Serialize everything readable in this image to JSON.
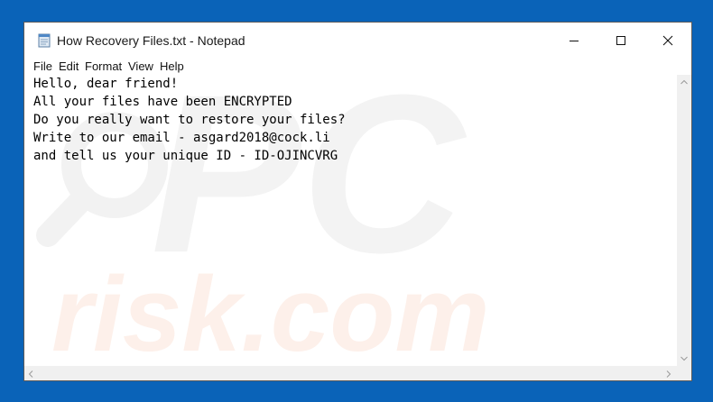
{
  "window": {
    "title": "How Recovery Files.txt - Notepad"
  },
  "menu": [
    "File",
    "Edit",
    "Format",
    "View",
    "Help"
  ],
  "content": {
    "lines": [
      "Hello, dear friend!",
      "All your files have been ENCRYPTED",
      "Do you really want to restore your files?",
      "Write to our email - asgard2018@cock.li",
      "and tell us your unique ID - ID-OJINCVRG"
    ]
  },
  "watermark": {
    "top": "PC",
    "bottom": "risk.com"
  },
  "icons": {
    "app": "notepad-icon",
    "minimize": "minimize-icon",
    "maximize": "maximize-icon",
    "close": "close-icon"
  },
  "colors": {
    "desktop": "#0a63b8",
    "window": "#ffffff",
    "text": "#000000",
    "scrollbar": "#f0f0f0"
  }
}
